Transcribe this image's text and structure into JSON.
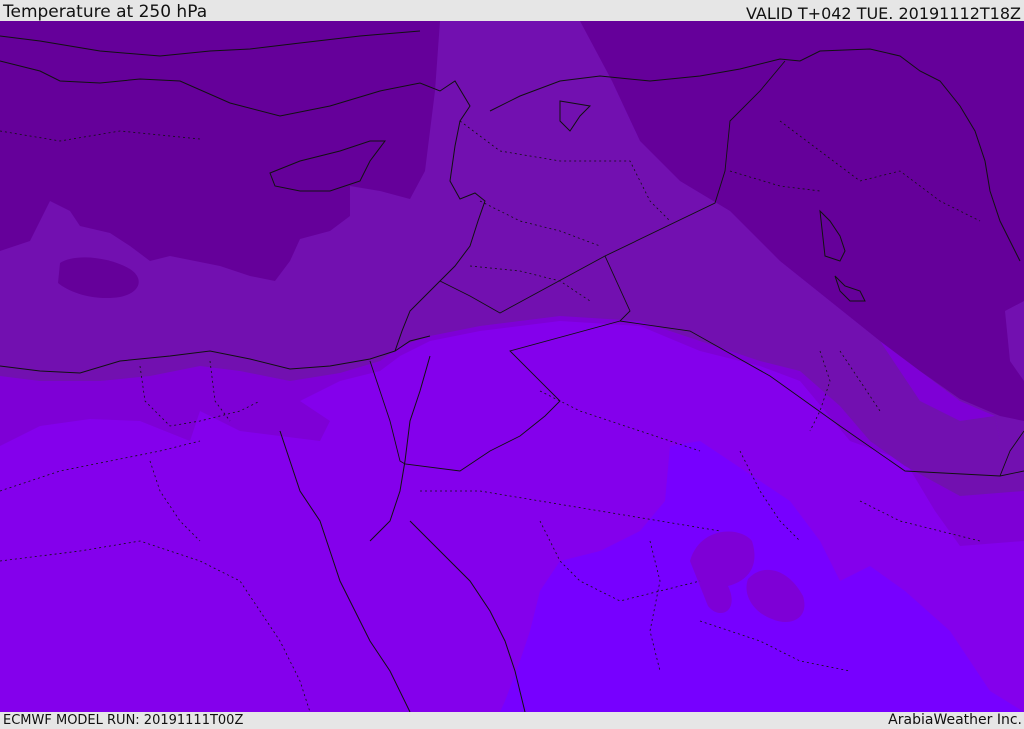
{
  "header": {
    "title": "Temperature at 250 hPa",
    "valid": "VALID T+042 TUE. 20191112T18Z"
  },
  "footer": {
    "run": "ECMWF MODEL RUN: 20191111T00Z",
    "credit": "ArabiaWeather Inc."
  },
  "map": {
    "band_colors": [
      "#65009a",
      "#7210b0",
      "#7e00d6",
      "#8400ec",
      "#7700ff"
    ],
    "border_color": "#111111"
  }
}
